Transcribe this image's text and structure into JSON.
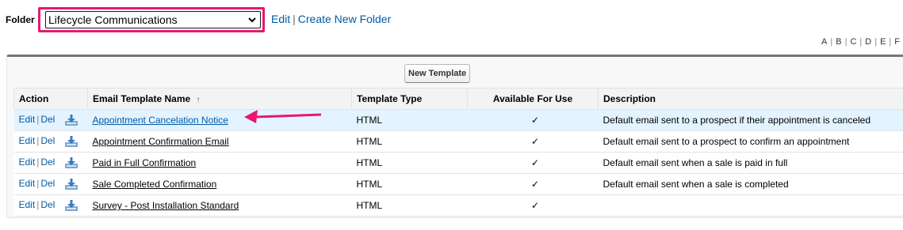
{
  "folder": {
    "label": "Folder",
    "selected": "Lifecycle Communications",
    "edit_label": "Edit",
    "separator": "|",
    "create_label": "Create New Folder"
  },
  "alphabet": [
    "A",
    "B",
    "C",
    "D",
    "E",
    "F"
  ],
  "toolbar": {
    "new_template_label": "New Template"
  },
  "table": {
    "headers": {
      "action": "Action",
      "name": "Email Template Name",
      "sort_indicator": "↑",
      "type": "Template Type",
      "available": "Available For Use",
      "description": "Description"
    },
    "edit_label": "Edit",
    "del_label": "Del",
    "action_separator": "|",
    "rows": [
      {
        "name": "Appointment Cancelation Notice",
        "type": "HTML",
        "available": "✓",
        "description": "Default email sent to a prospect if their appointment is canceled"
      },
      {
        "name": "Appointment Confirmation Email",
        "type": "HTML",
        "available": "✓",
        "description": "Default email sent to a prospect to confirm an appointment"
      },
      {
        "name": "Paid in Full Confirmation",
        "type": "HTML",
        "available": "✓",
        "description": "Default email sent when a sale is paid in full"
      },
      {
        "name": "Sale Completed Confirmation",
        "type": "HTML",
        "available": "✓",
        "description": "Default email sent when a sale is completed"
      },
      {
        "name": "Survey - Post Installation Standard",
        "type": "HTML",
        "available": "✓",
        "description": ""
      }
    ]
  },
  "colors": {
    "highlight": "#e8186f",
    "link": "#015ba7",
    "selected_row": "#e3f3ff",
    "panel_border": "#767676"
  }
}
